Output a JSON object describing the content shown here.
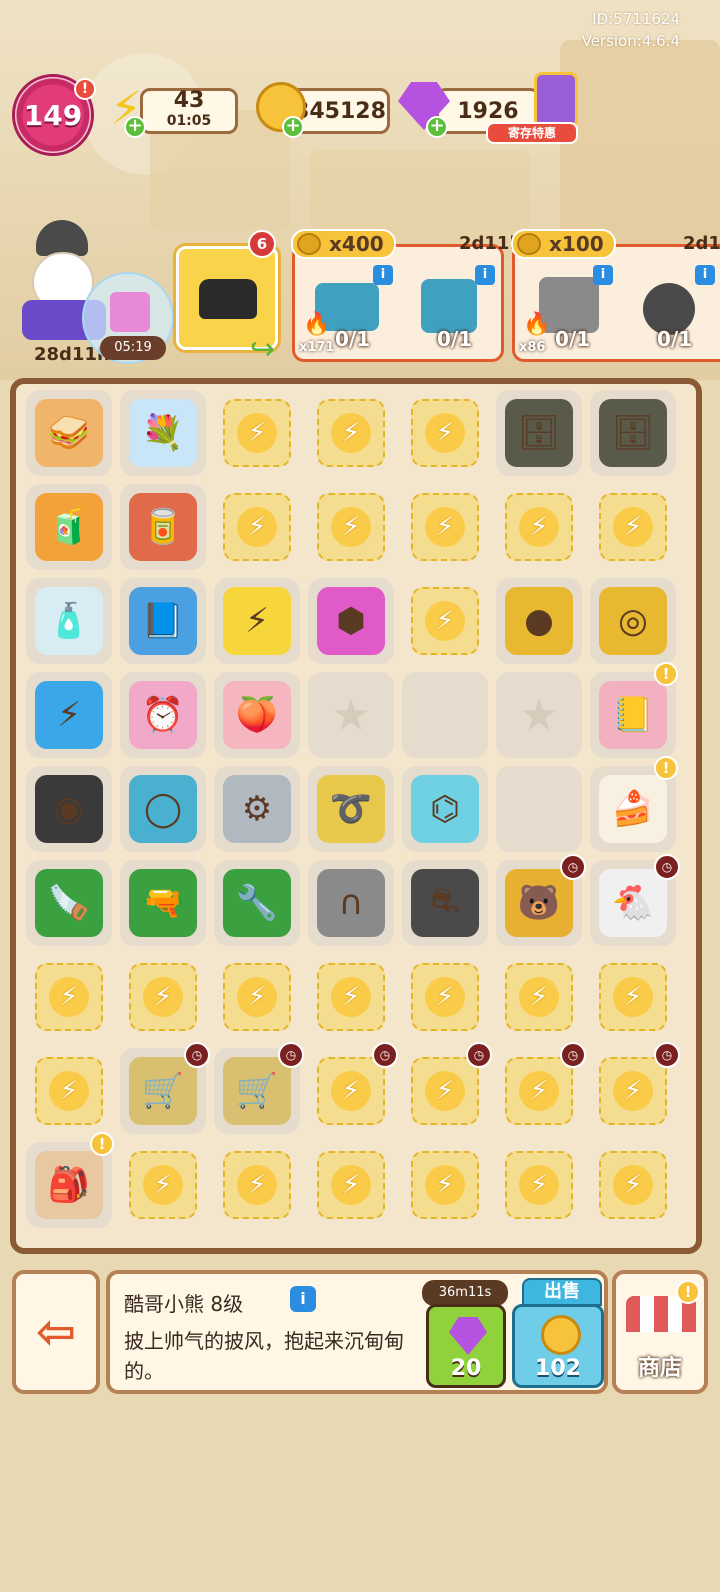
{
  "meta": {
    "id_text": "ID:5711624",
    "version_text": "Version:4.6.4"
  },
  "top_bar": {
    "level": "149",
    "energy": {
      "value": "43",
      "timer": "01:05"
    },
    "coins": {
      "value": "345128"
    },
    "gems": {
      "value": "1926"
    },
    "vip_badge": "寄存特惠",
    "alert_mark": "!"
  },
  "avatar": {
    "timer": "28d11h"
  },
  "gift_bubble": {
    "timer": "05:19"
  },
  "order": {
    "count": "6"
  },
  "quests": [
    {
      "reward": "x400",
      "time": "2d11h",
      "flame": "x171",
      "slots": [
        "0/1",
        "0/1"
      ]
    },
    {
      "reward": "x100",
      "time": "2d1",
      "flame": "x86",
      "slots": [
        "0/1",
        "0/1"
      ]
    }
  ],
  "board": {
    "rows": [
      [
        "sandwich",
        "flowers-vase",
        "locked-box",
        "locked-box",
        "locked-box",
        "locker",
        "locker"
      ],
      [
        "juice-bottle",
        "soda-can",
        "locked-box",
        "locked-box",
        "locked-box",
        "locked-box",
        "locked-box"
      ],
      [
        "spray-bottle",
        "notebook",
        "energy-coin",
        "gem-hexagon",
        "locked-map",
        "coin",
        "coin-stack"
      ],
      [
        "energy-orb",
        "alarm-clock",
        "peach",
        "empty-star",
        "empty",
        "empty-star",
        "diary"
      ],
      [
        "ab-wheel",
        "hula-hoop",
        "dumbbells",
        "jump-rope",
        "light-dumbbells",
        "empty",
        "cake-plate"
      ],
      [
        "hand-saw",
        "power-drill",
        "wrench",
        "hand-grip",
        "treadmill",
        "cool-bear",
        "chicken-desk"
      ],
      [
        "locked-box",
        "locked-box",
        "locked-fridge",
        "locked-bouquet",
        "locked-cart",
        "locked-robot",
        "locked-machine"
      ],
      [
        "locked-plant",
        "cart-timer",
        "cart-timer",
        "locked-case",
        "locked-case",
        "locked-case",
        "locked-case"
      ],
      [
        "cat-backpack",
        "locked-crate",
        "locked-crate",
        "locked-pineapple",
        "locked-pineapple",
        "locked-pineapple",
        "locked-pineapple"
      ]
    ]
  },
  "detail": {
    "name": "酷哥小熊 8级",
    "description": "披上帅气的披风，抱起来沉甸甸的。",
    "speedup_time": "36m11s",
    "speedup_cost": "20",
    "sell_label": "出售",
    "sell_price": "102"
  },
  "shop": {
    "label": "商店"
  },
  "colors": {
    "accent": "#e05a2c",
    "board_border": "#8a5a34",
    "lock_yellow": "#f6c33a"
  }
}
